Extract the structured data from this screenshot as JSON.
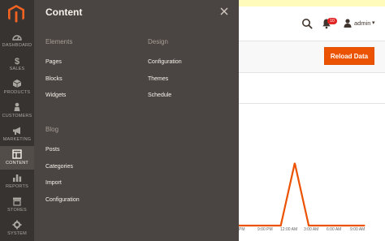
{
  "nav": {
    "items": [
      {
        "label": "DASHBOARD",
        "icon": "dashboard-icon"
      },
      {
        "label": "SALES",
        "icon": "dollar-icon"
      },
      {
        "label": "PRODUCTS",
        "icon": "cube-icon"
      },
      {
        "label": "CUSTOMERS",
        "icon": "person-icon"
      },
      {
        "label": "MARKETING",
        "icon": "megaphone-icon"
      },
      {
        "label": "CONTENT",
        "icon": "layout-icon"
      },
      {
        "label": "REPORTS",
        "icon": "bar-chart-icon"
      },
      {
        "label": "STORES",
        "icon": "store-icon"
      },
      {
        "label": "SYSTEM",
        "icon": "gear-icon"
      }
    ],
    "active": "CONTENT"
  },
  "panel": {
    "title": "Content",
    "groups": [
      {
        "title": "Elements",
        "items": [
          "Pages",
          "Blocks",
          "Widgets"
        ]
      },
      {
        "title": "Design",
        "items": [
          "Configuration",
          "Themes",
          "Schedule"
        ]
      },
      {
        "title": "Blog",
        "items": [
          "Posts",
          "Categories",
          "Import",
          "Configuration"
        ]
      }
    ]
  },
  "header": {
    "notification_count": "10",
    "username": "admin",
    "caret": "▾"
  },
  "actions": {
    "reload_label": "Reload Data"
  },
  "chart_data": {
    "type": "line",
    "x": [
      "",
      "9:00 PM",
      "12:00 AM",
      "3:00 AM",
      "6:00 AM"
    ],
    "x_tick_labels": [
      "PM",
      "9:00 PM",
      "12:00 AM",
      "3:00 AM",
      "6:00 AM",
      "9:00 AM"
    ],
    "values": [
      0,
      0,
      0,
      0,
      1,
      0,
      0,
      0,
      0,
      0
    ],
    "color": "#eb5202"
  },
  "colors": {
    "nav_bg": "#373330",
    "panel_bg": "#4a4542",
    "accent": "#eb5202",
    "brand": "#f26322"
  }
}
